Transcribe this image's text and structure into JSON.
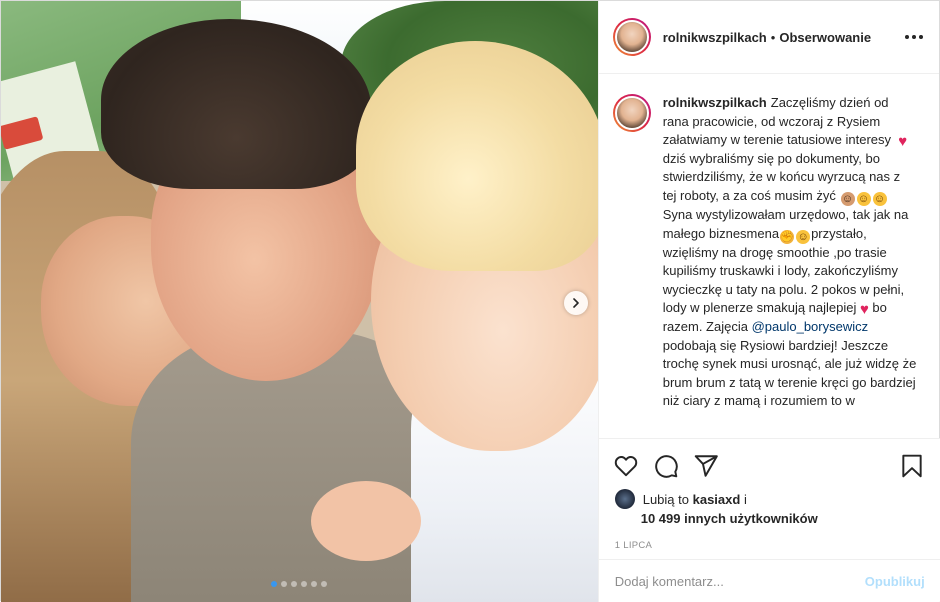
{
  "post": {
    "author": "rolnikwszpilkach",
    "follow_label": "Obserwowanie",
    "separator": "•",
    "caption": {
      "author": "rolnikwszpilkach",
      "part1": "Zaczęliśmy dzień od rana pracowicie, od wczoraj z Rysiem załatwiamy w terenie tatusiowe interesy",
      "part2": "dziś wybraliśmy się po dokumenty, bo stwierdziliśmy, że w końcu wyrzucą nas z tej roboty, a za coś musim żyć",
      "part3": "Syna wystylizowałam urzędowo, tak jak na małego biznesmena",
      "part4": "przystało, wzięliśmy na drogę smoothie ,po trasie kupiliśmy truskawki i lody, zakończyliśmy wycieczkę u taty na polu. 2 pokos w pełni, lody w plenerze smakują najlepiej",
      "part5": "bo razem. Zajęcia",
      "mention": "@paulo_borysewicz",
      "part6": "podobają się Rysiowi bardziej! Jeszcze trochę synek musi urosnąć, ale już widzę że brum brum z tatą w terenie kręci go bardziej niż ciary z mamą i rozumiem to w"
    },
    "likes": {
      "prefix": "Lubią to",
      "user": "kasiaxd",
      "suffix": "i",
      "others": "10 499 innych użytkowników"
    },
    "date": "1 LIPCA",
    "comment": {
      "placeholder": "Dodaj komentarz...",
      "publish_label": "Opublikuj"
    },
    "carousel": {
      "total": 6,
      "active": 0
    }
  },
  "icons": [
    "heart-icon",
    "comment-icon",
    "share-icon",
    "bookmark-icon",
    "more-icon",
    "chevron-right-icon"
  ],
  "colors": {
    "accent": "#3897f0",
    "publish_disabled": "#b2dffc",
    "mention": "#00376b",
    "heart": "#e0245e",
    "muted": "#8e8e8e"
  }
}
